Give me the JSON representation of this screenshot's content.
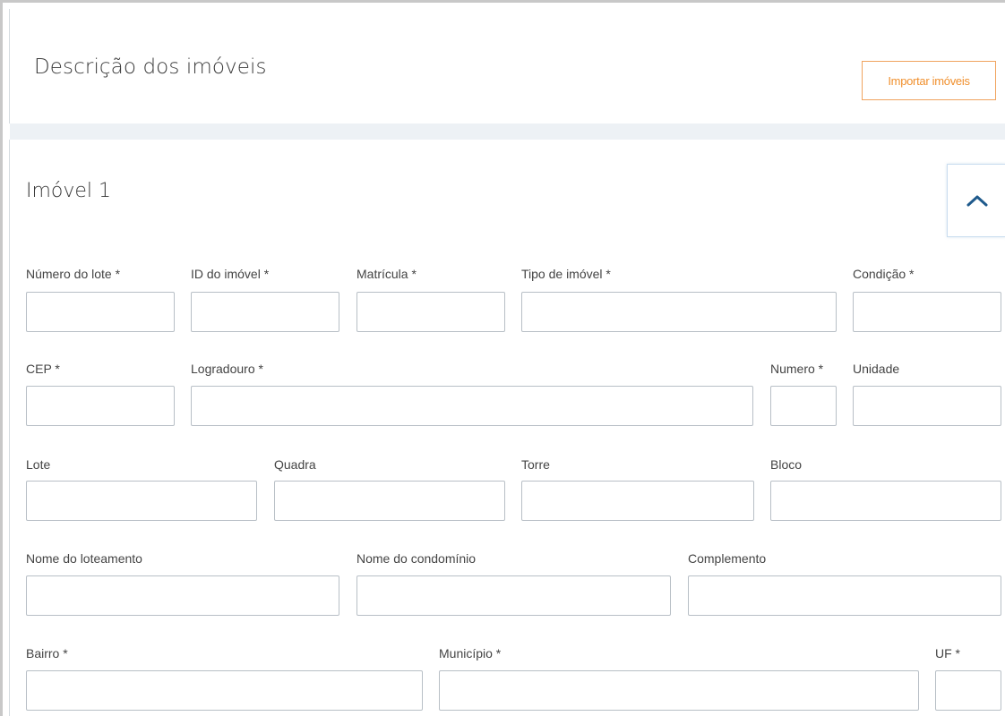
{
  "header": {
    "title": "Descrição dos imóveis",
    "import_button": "Importar imóveis"
  },
  "property": {
    "title": "Imóvel 1",
    "collapse_icon": "chevron-up-icon",
    "accent_color": "#1f5a8c"
  },
  "fields": {
    "numero_lote": {
      "label": "Número do lote *",
      "value": ""
    },
    "id_imovel": {
      "label": "ID do imóvel *",
      "value": ""
    },
    "matricula": {
      "label": "Matrícula *",
      "value": ""
    },
    "tipo_imovel": {
      "label": "Tipo de imóvel *",
      "value": ""
    },
    "condicao": {
      "label": "Condição *",
      "value": ""
    },
    "cep": {
      "label": "CEP *",
      "value": ""
    },
    "logradouro": {
      "label": "Logradouro *",
      "value": ""
    },
    "numero": {
      "label": "Numero *",
      "value": ""
    },
    "unidade": {
      "label": "Unidade",
      "value": ""
    },
    "lote": {
      "label": "Lote",
      "value": ""
    },
    "quadra": {
      "label": "Quadra",
      "value": ""
    },
    "torre": {
      "label": "Torre",
      "value": ""
    },
    "bloco": {
      "label": "Bloco",
      "value": ""
    },
    "nome_loteamento": {
      "label": "Nome do loteamento",
      "value": ""
    },
    "nome_condominio": {
      "label": "Nome do condomínio",
      "value": ""
    },
    "complemento": {
      "label": "Complemento",
      "value": ""
    },
    "bairro": {
      "label": "Bairro *",
      "value": ""
    },
    "municipio": {
      "label": "Município *",
      "value": ""
    },
    "uf": {
      "label": "UF *",
      "value": ""
    }
  }
}
